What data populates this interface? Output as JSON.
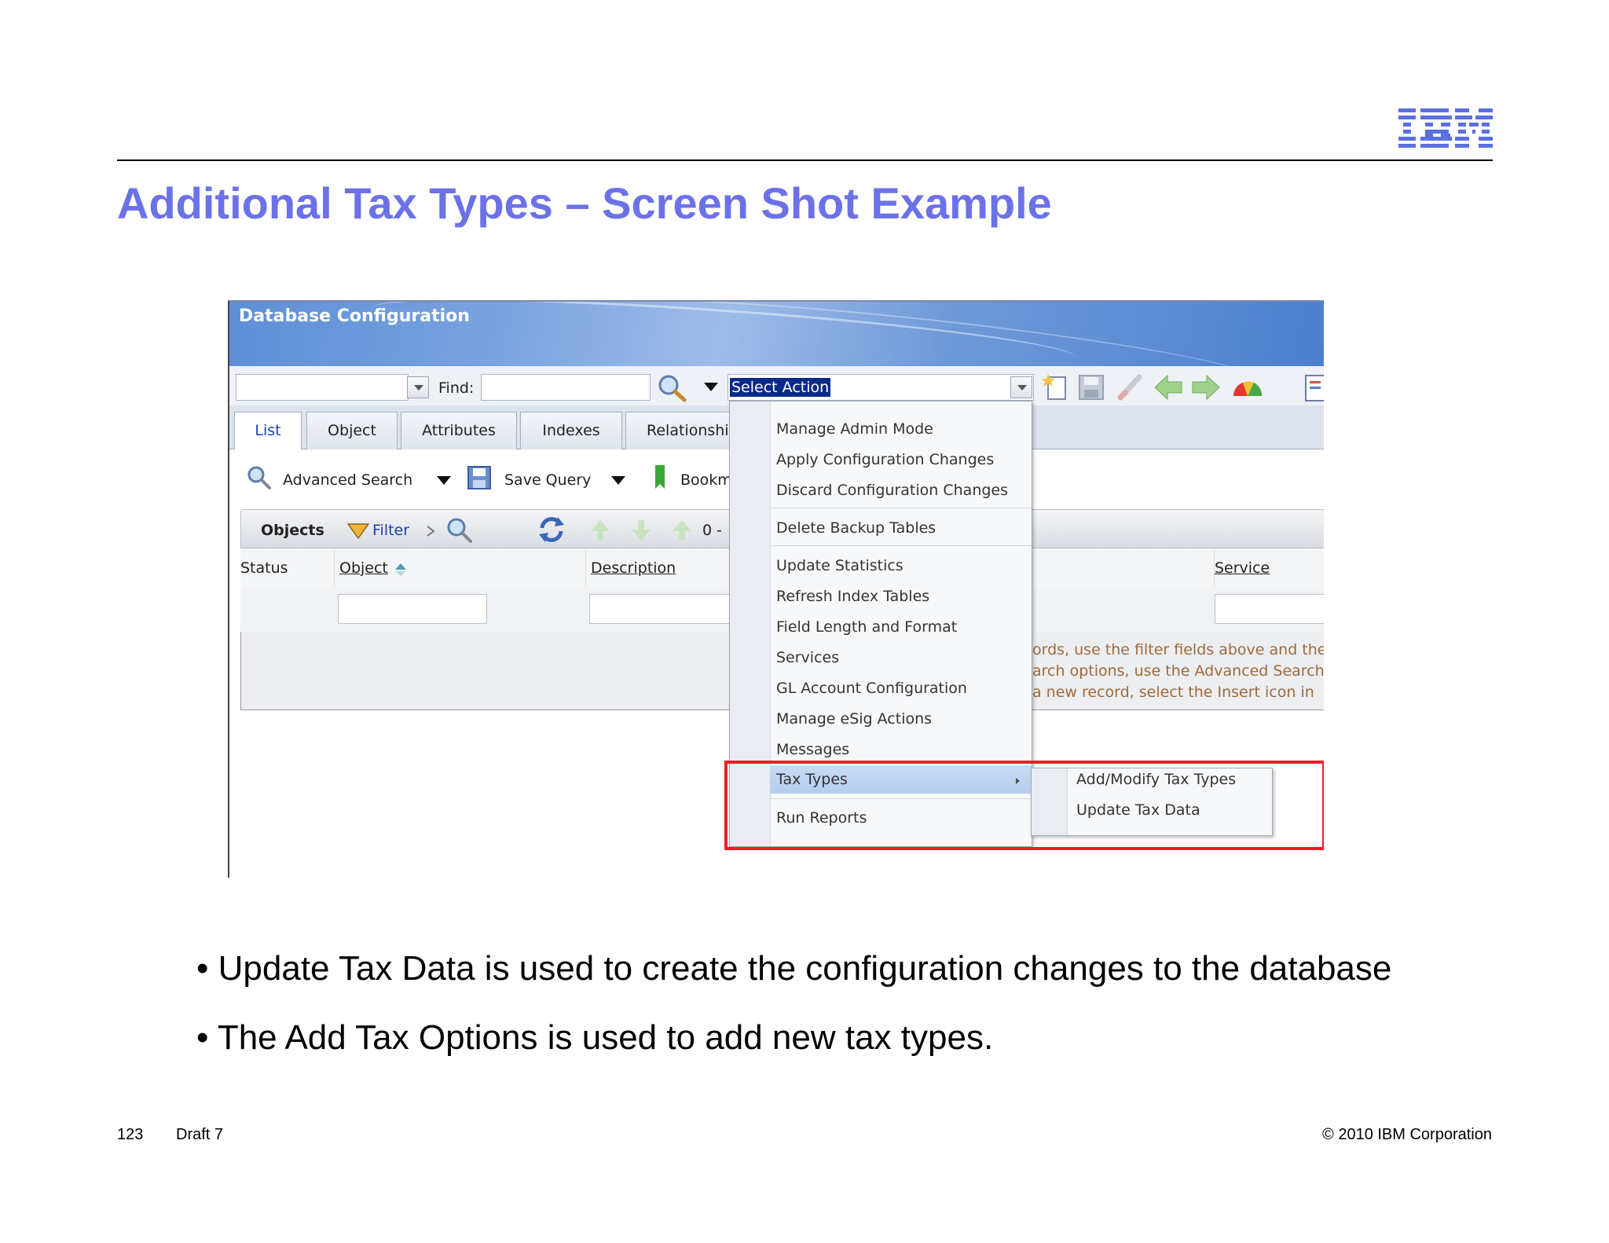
{
  "slide": {
    "title": "Additional Tax Types – Screen Shot Example",
    "bullets": [
      "• Update Tax Data is used to create the configuration changes to the database",
      "•  The Add Tax Options is used to add new tax types."
    ],
    "footer": {
      "page_number": "123",
      "draft": "Draft 7",
      "copyright": "© 2010 IBM Corporation"
    },
    "logo_text": "IBM",
    "title_color": "#6b72e8"
  },
  "app": {
    "title": "Database Configuration",
    "find_label": "Find:",
    "select_action": "Select Action",
    "tabs": [
      "List",
      "Object",
      "Attributes",
      "Indexes",
      "Relationship"
    ],
    "toolbar2": {
      "advanced_search": "Advanced Search",
      "save_query": "Save Query",
      "bookmarks": "Bookm"
    },
    "objects_bar": {
      "label": "Objects",
      "filter": "Filter",
      "range": "0 - "
    },
    "columns": [
      "Status",
      "Object",
      "Description",
      "Service"
    ],
    "hint_lines": [
      "ords, use the filter fields above and the",
      "arch options, use the Advanced Search",
      " a new record, select the Insert icon in"
    ],
    "menu_items": [
      "Manage Admin Mode",
      "Apply Configuration Changes",
      "Discard Configuration Changes",
      "Delete Backup Tables",
      "Update Statistics",
      "Refresh Index Tables",
      "Field Length and Format",
      "Services",
      "GL Account Configuration",
      "Manage eSig Actions",
      "Messages",
      "Tax Types",
      "Run Reports"
    ],
    "submenu_items": [
      "Add/Modify Tax Types",
      "Update Tax Data"
    ],
    "highlight_color": "#ee1c24",
    "icons": [
      "search-icon",
      "new-record-icon",
      "save-icon",
      "clear-icon",
      "previous-arrow-icon",
      "next-arrow-icon",
      "gauge-icon",
      "report-icon",
      "bookmark-icon",
      "filter-icon",
      "refresh-icon"
    ]
  }
}
